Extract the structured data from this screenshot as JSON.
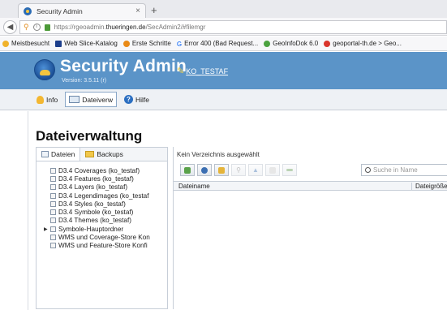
{
  "browser": {
    "tab_title": "Security Admin",
    "tab_close": "×",
    "new_tab": "+",
    "url_prefix": "https://rgeoadmin.",
    "url_domain": "thueringen.de",
    "url_path": "/SecAdmin2/#filemgr",
    "bookmarks": [
      {
        "label": "Meistbesucht",
        "icon": "star-icon"
      },
      {
        "label": "Web Slice-Katalog",
        "icon": "webslice-icon"
      },
      {
        "label": "Erste Schritte",
        "icon": "firststeps-icon"
      },
      {
        "label": "Error 400 (Bad Request...",
        "icon": "google-icon"
      },
      {
        "label": "GeoInfoDok 6.0",
        "icon": "clock-icon"
      },
      {
        "label": "geoportal-th.de > Geo...",
        "icon": "geoportal-icon"
      }
    ]
  },
  "app": {
    "title": "Security Admin",
    "version": "Version: 3.5.11 (r)",
    "user": "KO_TESTAF",
    "brand_color": "#5b94c8",
    "tabs": [
      {
        "label": "Info",
        "icon": "bulb-icon"
      },
      {
        "label": "Dateiverw",
        "icon": "files-icon"
      },
      {
        "label": "Hilfe",
        "icon": "help-icon"
      }
    ]
  },
  "main": {
    "page_title": "Dateiverwaltung",
    "left_tabs": [
      {
        "label": "Dateien"
      },
      {
        "label": "Backups"
      }
    ],
    "tree": [
      {
        "label": "D3.4 Coverages (ko_testaf)"
      },
      {
        "label": "D3.4 Features (ko_testaf)"
      },
      {
        "label": "D3.4 Layers (ko_testaf)"
      },
      {
        "label": "D3.4 Legendimages (ko_testaf"
      },
      {
        "label": "D3.4 Styles (ko_testaf)"
      },
      {
        "label": "D3.4 Symbole (ko_testaf)"
      },
      {
        "label": "D3.4 Themes (ko_testaf)"
      },
      {
        "label": "Symbole-Hauptordner"
      },
      {
        "label": "WMS und Coverage-Store Kon"
      },
      {
        "label": "WMS und Feature-Store Konfi"
      }
    ],
    "status": "Kein Verzeichnis ausgewählt",
    "search_placeholder": "Suche in Name",
    "columns": {
      "name": "Dateiname",
      "size": "Dateigröße"
    }
  }
}
